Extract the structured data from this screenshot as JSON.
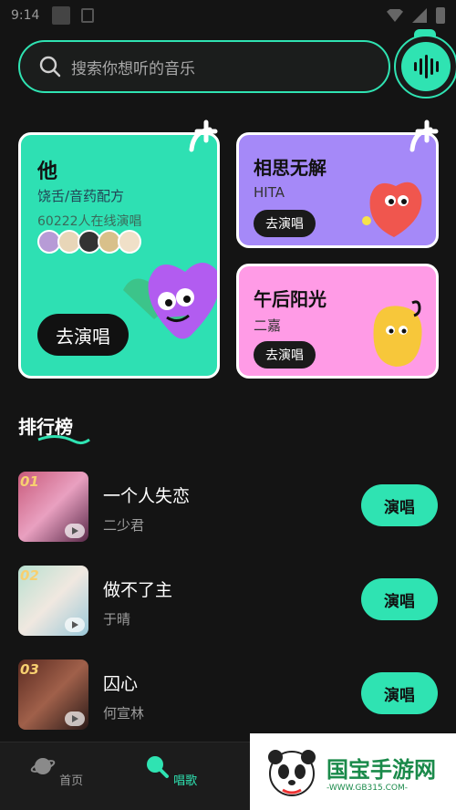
{
  "status": {
    "time": "9:14"
  },
  "search": {
    "placeholder": "搜索你想听的音乐"
  },
  "featured": {
    "big": {
      "title": "他",
      "subtitle": "饶舌/音药配方",
      "online": "60222人在线演唱",
      "button": "去演唱"
    },
    "small": [
      {
        "title": "相思无解",
        "artist": "HITA",
        "button": "去演唱"
      },
      {
        "title": "午后阳光",
        "artist": "二嘉",
        "button": "去演唱"
      }
    ]
  },
  "ranking": {
    "title": "排行榜",
    "items": [
      {
        "rank": "01",
        "name": "一个人失恋",
        "artist": "二少君",
        "button": "演唱"
      },
      {
        "rank": "02",
        "name": "做不了主",
        "artist": "于晴",
        "button": "演唱"
      },
      {
        "rank": "03",
        "name": "囚心",
        "artist": "何宣林",
        "button": "演唱"
      }
    ]
  },
  "nav": {
    "home": "首页",
    "sing": "唱歌"
  },
  "watermark": {
    "text": "国宝手游网",
    "url": "-WWW.GB315.COM-"
  },
  "colors": {
    "accent": "#2fe3b2",
    "background": "#141414"
  }
}
